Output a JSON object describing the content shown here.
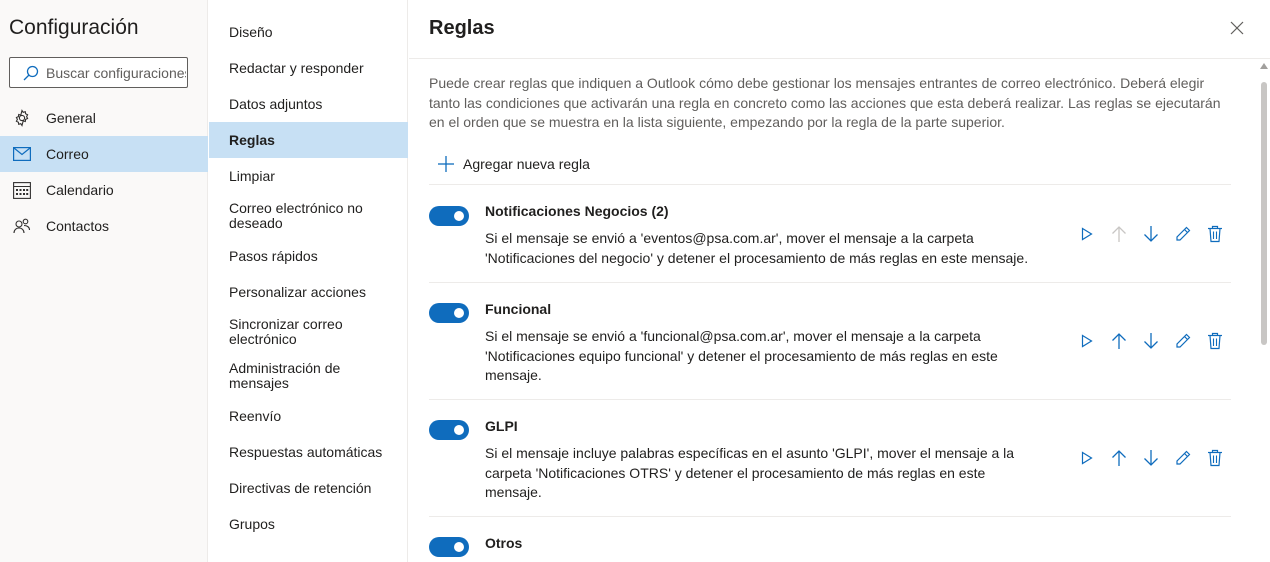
{
  "settings": {
    "title": "Configuración",
    "search_placeholder": "Buscar configuraciones",
    "categories": [
      {
        "label": "General",
        "icon": "gear-icon"
      },
      {
        "label": "Correo",
        "icon": "mail-icon"
      },
      {
        "label": "Calendario",
        "icon": "calendar-icon"
      },
      {
        "label": "Contactos",
        "icon": "people-icon"
      }
    ],
    "active_category": "Correo"
  },
  "mail_menu": {
    "items": [
      "Diseño",
      "Redactar y responder",
      "Datos adjuntos",
      "Reglas",
      "Limpiar",
      "Correo electrónico no deseado",
      "Pasos rápidos",
      "Personalizar acciones",
      "Sincronizar correo electrónico",
      "Administración de mensajes",
      "Reenvío",
      "Respuestas automáticas",
      "Directivas de retención",
      "Grupos"
    ],
    "active": "Reglas"
  },
  "rules_panel": {
    "title": "Reglas",
    "description": "Puede crear reglas que indiquen a Outlook cómo debe gestionar los mensajes entrantes de correo electrónico. Deberá elegir tanto las condiciones que activarán una regla en concreto como las acciones que esta deberá realizar. Las reglas se ejecutarán en el orden que se muestra en la lista siguiente, empezando por la regla de la parte superior.",
    "add_label": "Agregar nueva regla",
    "rules": [
      {
        "name": "Notificaciones Negocios (2)",
        "enabled": true,
        "description": "Si el mensaje se envió a 'eventos@psa.com.ar', mover el mensaje a la carpeta 'Notificaciones del negocio' y detener el procesamiento de más reglas en este mensaje."
      },
      {
        "name": "Funcional",
        "enabled": true,
        "description": "Si el mensaje se envió a 'funcional@psa.com.ar', mover el mensaje a la carpeta 'Notificaciones equipo funcional' y detener el procesamiento de más reglas en este mensaje."
      },
      {
        "name": "GLPI",
        "enabled": true,
        "description": "Si el mensaje incluye palabras específicas en el asunto 'GLPI', mover el mensaje a la carpeta 'Notificaciones OTRS' y detener el procesamiento de más reglas en este mensaje."
      },
      {
        "name": "Otros",
        "enabled": true,
        "description": ""
      }
    ]
  },
  "colors": {
    "accent": "#0f6cbd",
    "selected_bg": "#c7e0f4",
    "sidebar_bg": "#faf9f8"
  }
}
